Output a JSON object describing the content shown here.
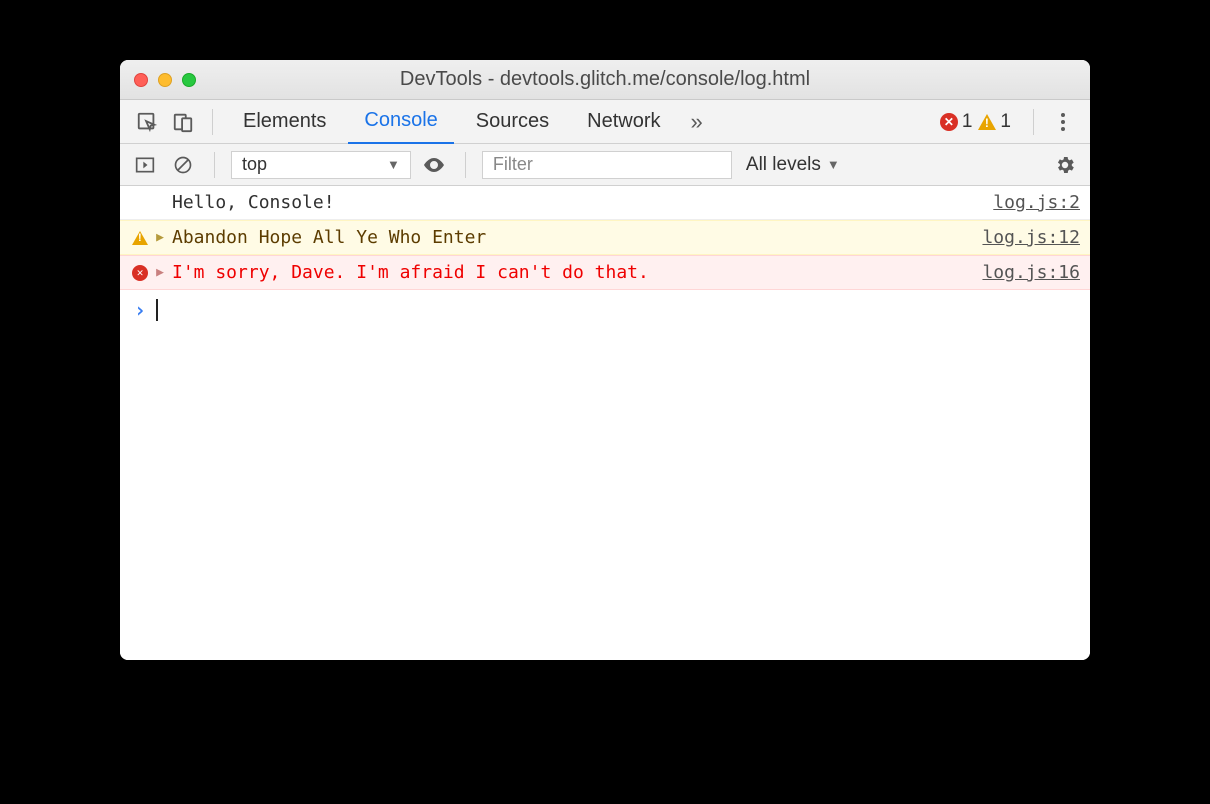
{
  "window": {
    "title": "DevTools - devtools.glitch.me/console/log.html"
  },
  "tabs": {
    "items": [
      "Elements",
      "Console",
      "Sources",
      "Network"
    ],
    "active_index": 1,
    "error_count": "1",
    "warn_count": "1"
  },
  "filterbar": {
    "context": "top",
    "filter_placeholder": "Filter",
    "levels_label": "All levels"
  },
  "console": {
    "rows": [
      {
        "type": "log",
        "message": "Hello, Console!",
        "source": "log.js:2",
        "expandable": false
      },
      {
        "type": "warn",
        "message": "Abandon Hope All Ye Who Enter",
        "source": "log.js:12",
        "expandable": true
      },
      {
        "type": "error",
        "message": "I'm sorry, Dave. I'm afraid I can't do that.",
        "source": "log.js:16",
        "expandable": true
      }
    ]
  }
}
